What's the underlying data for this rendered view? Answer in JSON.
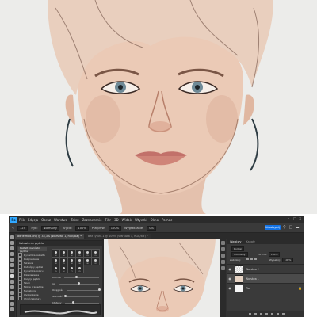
{
  "menubar": {
    "logo": "Ps",
    "items": [
      "Plik",
      "Edycja",
      "Obraz",
      "Warstwa",
      "Tekst",
      "Zaznaczenie",
      "Filtr",
      "3D",
      "Widok",
      "Wtyczki",
      "Okno",
      "Pomoc"
    ]
  },
  "options": {
    "size": "125",
    "mode_label": "Tryb:",
    "mode_value": "Normalny",
    "opacity_label": "Krycie:",
    "opacity_value": "100%",
    "flow_label": "Przepływ:",
    "flow_value": "100%",
    "smooth_label": "Wygładzanie:",
    "smooth_value": "0%",
    "share_label": "Udostępnij"
  },
  "tabs": {
    "active": "adrie mod.png @ 33,3% (Warstwa 1, RGB/8#) *",
    "second": "Bez tytułu-1 @ 100% (Warstwa 1, RGB/8#) *"
  },
  "brush_panel": {
    "title": "Ustawienia pędzla",
    "preset_button": "Kształt końcówki pędzla",
    "list": [
      "Dynamika kształtu",
      "Rozpraszanie",
      "Tekstura",
      "Podwójny pędzel",
      "Dynamika koloru",
      "Przeniesienie",
      "Pozycja pędzla",
      "Szum",
      "Mokre krawędzie",
      "Narastanie",
      "Wygładzanie",
      "Chroń teksturę"
    ],
    "swatch_sizes": [
      "30",
      "30",
      "30",
      "25",
      "25",
      "25",
      "36",
      "25",
      "36",
      "36",
      "36",
      "32",
      "25",
      "50",
      "71",
      "25"
    ],
    "slider_labels": [
      "Rozmiar",
      "Kąt",
      "Okrągłość",
      "Twardość",
      "Odstępy"
    ],
    "slider_levels": [
      0.35,
      0.5,
      1.0,
      0.0,
      0.25
    ]
  },
  "layers_panel": {
    "tab_layers": "Warstwy",
    "tab_channels": "Kanały",
    "filter_label": "Rodzaj",
    "blend_value": "Normalny",
    "opacity_label": "Krycie:",
    "opacity_value": "100%",
    "lock_label": "Zablokuj:",
    "fill_label": "Wypełnij:",
    "fill_value": "100%",
    "layers": [
      {
        "name": "Warstwa 2"
      },
      {
        "name": "Warstwa 1"
      },
      {
        "name": "Tło"
      }
    ]
  },
  "colors": {
    "accent": "#1473e6",
    "ps_blue": "#31a8ff",
    "panel": "#3a3a3a",
    "skin": "#e7c6b4",
    "hair": "#e9cfbe"
  }
}
